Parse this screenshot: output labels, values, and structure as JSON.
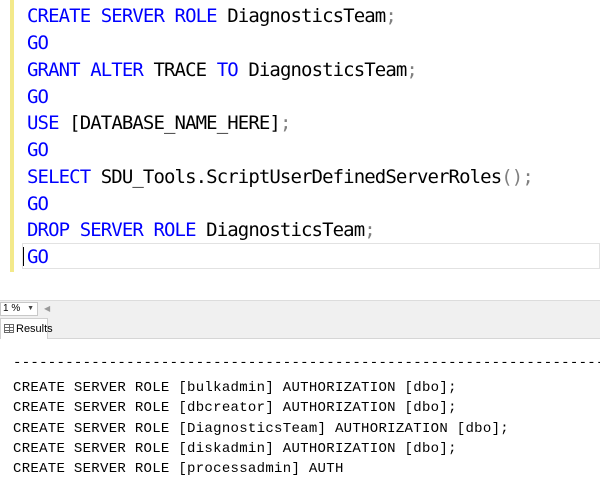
{
  "editor": {
    "lines": [
      {
        "kw1": "CREATE SERVER ROLE",
        "rest": " DiagnosticsTeam",
        "punct": ";"
      },
      {
        "kw1": "GO"
      },
      {
        "kw1": "GRANT ALTER",
        "mid": " TRACE ",
        "kw2": "TO",
        "rest": " DiagnosticsTeam",
        "punct": ";"
      },
      {
        "kw1": "GO"
      },
      {
        "kw1": "USE",
        "rest": " [DATABASE_NAME_HERE]",
        "punct": ";"
      },
      {
        "kw1": "GO"
      },
      {
        "kw1": "SELECT",
        "rest": " SDU_Tools.ScriptUserDefinedServerRoles",
        "punct": "();"
      },
      {
        "kw1": "GO"
      },
      {
        "kw1": "DROP SERVER ROLE",
        "rest": " DiagnosticsTeam",
        "punct": ";"
      },
      {
        "kw1": "GO"
      }
    ]
  },
  "status": {
    "zoom": "1 %"
  },
  "tabs": {
    "results_label": "Results"
  },
  "results": {
    "separator": "-------------------------------------------------------------------------------------",
    "rows": [
      "CREATE SERVER ROLE [bulkadmin] AUTHORIZATION [dbo];",
      "CREATE SERVER ROLE [dbcreator] AUTHORIZATION [dbo];",
      "CREATE SERVER ROLE [DiagnosticsTeam] AUTHORIZATION [dbo];",
      "CREATE SERVER ROLE [diskadmin] AUTHORIZATION [dbo];",
      "CREATE SERVER ROLE [processadmin] AUTH"
    ]
  }
}
